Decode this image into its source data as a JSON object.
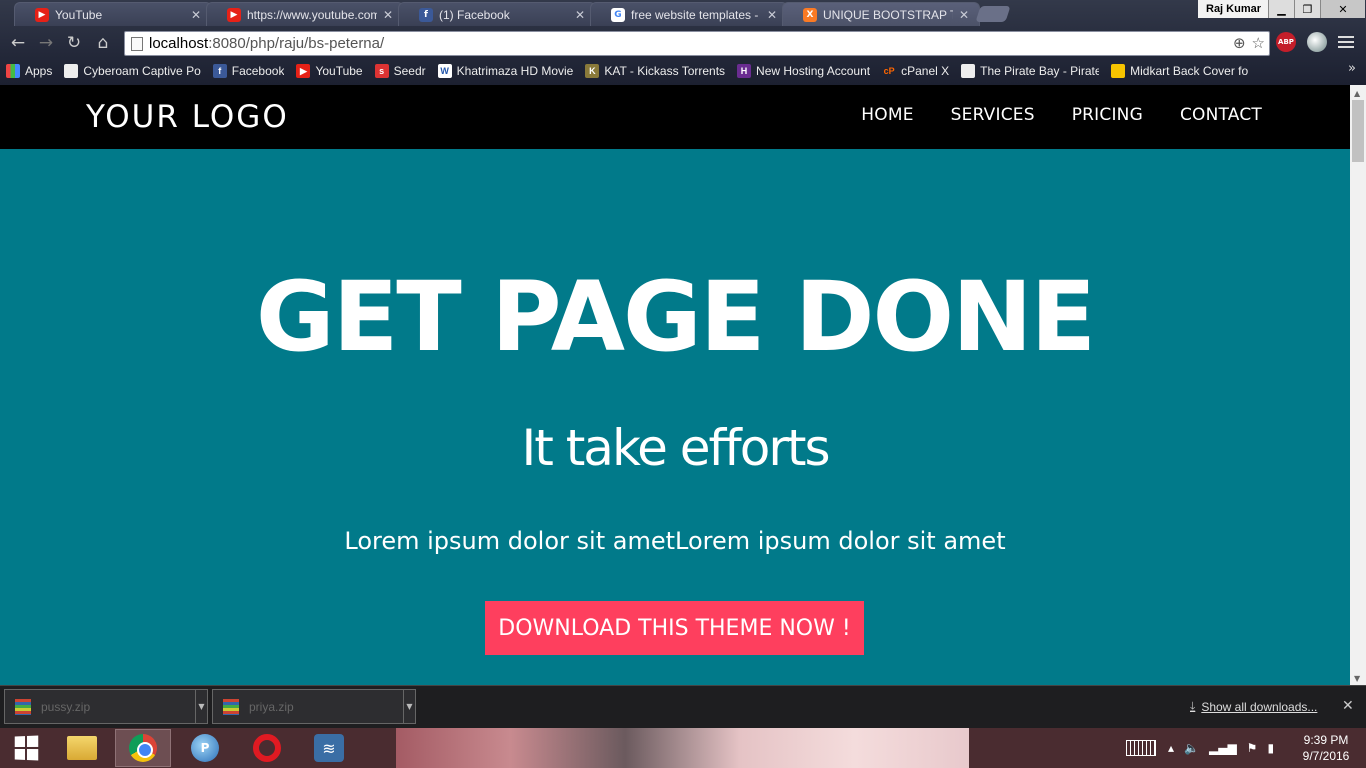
{
  "browser": {
    "tabs": [
      {
        "title": "YouTube",
        "icon": "youtube-icon",
        "color": "#e62117"
      },
      {
        "title": "https://www.youtube.com",
        "icon": "youtube-icon",
        "color": "#e62117"
      },
      {
        "title": "(1) Facebook",
        "icon": "facebook-icon",
        "color": "#3b5998"
      },
      {
        "title": "free website templates - G",
        "icon": "google-icon",
        "color": "#ffffff"
      },
      {
        "title": "UNIQUE BOOTSTRAP TEM",
        "icon": "xampp-icon",
        "color": "#fb7a24"
      }
    ],
    "user_name": "Raj Kumar",
    "url_host": "localhost",
    "url_path": ":8080/php/raju/bs-peterna/",
    "bookmarks": [
      {
        "label": "Apps",
        "icon": "apps-grid-icon"
      },
      {
        "label": "Cyberoam Captive Po",
        "icon": "page-icon"
      },
      {
        "label": "Facebook",
        "icon": "facebook-icon"
      },
      {
        "label": "YouTube",
        "icon": "youtube-icon"
      },
      {
        "label": "Seedr",
        "icon": "seedr-icon"
      },
      {
        "label": "Khatrimaza HD Movie",
        "icon": "w-icon"
      },
      {
        "label": "KAT - Kickass Torrents",
        "icon": "kat-icon"
      },
      {
        "label": "New Hosting Account",
        "icon": "hosting-icon"
      },
      {
        "label": "cPanel X",
        "icon": "cpanel-icon"
      },
      {
        "label": "The Pirate Bay - Pirate",
        "icon": "piratebay-icon"
      },
      {
        "label": "Midkart Back Cover fo",
        "icon": "midkart-icon"
      }
    ]
  },
  "site": {
    "logo": "YOUR LOGO",
    "nav": [
      "HOME",
      "SERVICES",
      "PRICING",
      "CONTACT"
    ],
    "hero_title": "GET PAGE DONE",
    "hero_subtitle": "It take efforts",
    "hero_text": "Lorem ipsum dolor sit ametLorem ipsum dolor sit amet",
    "hero_button": "DOWNLOAD THIS THEME NOW !",
    "colors": {
      "hero_bg": "#017a8a",
      "button_bg": "#fe3f5e",
      "nav_bg": "#000000"
    }
  },
  "downloads": {
    "items": [
      "pussy.zip",
      "priya.zip"
    ],
    "show_all": "Show all downloads..."
  },
  "taskbar": {
    "time": "9:39 PM",
    "date": "9/7/2016"
  }
}
